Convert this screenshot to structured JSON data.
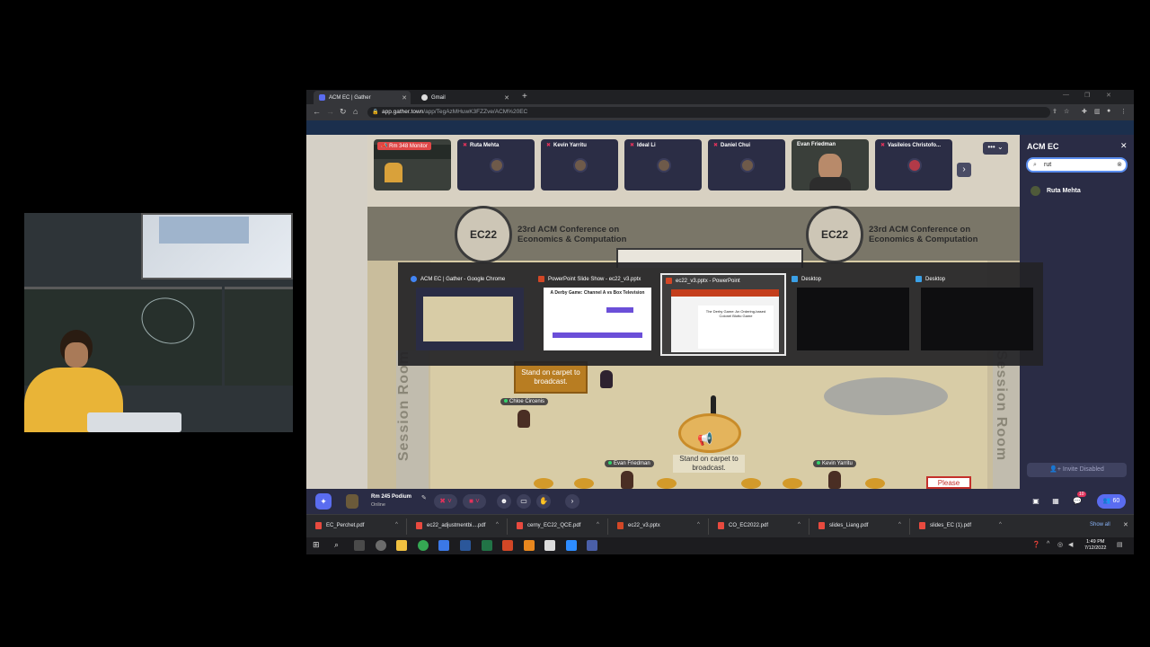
{
  "browser": {
    "tabs": [
      {
        "label": "ACM EC | Gather",
        "active": true
      },
      {
        "label": "Gmail",
        "active": false
      }
    ],
    "url_host": "app.gather.town",
    "url_path": "/app/TegAzMHuwK3FZZve/ACM%20EC"
  },
  "gather": {
    "participants": [
      {
        "name": "Rm 348 Monitor",
        "video": true
      },
      {
        "name": "Ruta Mehta",
        "video": false
      },
      {
        "name": "Kevin Yarritu",
        "video": false
      },
      {
        "name": "Ideal Li",
        "video": false
      },
      {
        "name": "Daniel Chui",
        "video": false
      },
      {
        "name": "Evan Friedman",
        "video": true
      },
      {
        "name": "Vasileios Christofo...",
        "video": false
      }
    ],
    "conference_title_line1": "23rd ACM Conference on",
    "conference_title_line2": "Economics & Computation",
    "seal_text": "EC22",
    "session_room_label": "Session Room",
    "carpet_label": "Stand on carpet to broadcast.",
    "podium_label": "Stand on carpet to broadcast.",
    "please_sign": "Please",
    "avatars": [
      {
        "name": "Chloe Circenis"
      },
      {
        "name": "Evan Friedman"
      },
      {
        "name": "Kevin Yarritu"
      }
    ],
    "more_button": "••• ⌄",
    "next_button": "›"
  },
  "panel": {
    "title": "ACM EC",
    "search_value": "rut",
    "result_name": "Ruta Mehta",
    "invite_label": "Invite Disabled"
  },
  "alttab": {
    "items": [
      {
        "title": "ACM EC | Gather - Google Chrome",
        "icon_color": "#4285f4"
      },
      {
        "title": "PowerPoint Slide Show  -  ec22_v3.pptx",
        "icon_color": "#d24726"
      },
      {
        "title": "ec22_v3.pptx - PowerPoint",
        "icon_color": "#d24726"
      },
      {
        "title": "Desktop",
        "icon_color": "#3ba0e6"
      },
      {
        "title": "Desktop",
        "icon_color": "#3ba0e6"
      }
    ],
    "slide1_title": "A Derby Game: Channel A vs Box Television",
    "slide2_title": "The Derby Game: An Ordering-based Colonel Blotto Game"
  },
  "bottombar": {
    "room_name": "Rm 245 Podium",
    "status": "Online",
    "participant_count": "60",
    "chat_badge": "10"
  },
  "downloads": {
    "files": [
      "EC_Perchet.pdf",
      "ec22_adjustmentbi....pdf",
      "cerny_EC22_QCE.pdf",
      "ec22_v3.pptx",
      "CO_EC2022.pdf",
      "slides_Liang.pdf",
      "slides_EC (1).pdf"
    ],
    "show_all": "Show all"
  },
  "taskbar": {
    "time": "1:49 PM",
    "date": "7/12/2022"
  },
  "colors": {
    "gather_panel": "#2a2c45",
    "gather_accent": "#5a6cf0",
    "mute_red": "#e0325b"
  }
}
